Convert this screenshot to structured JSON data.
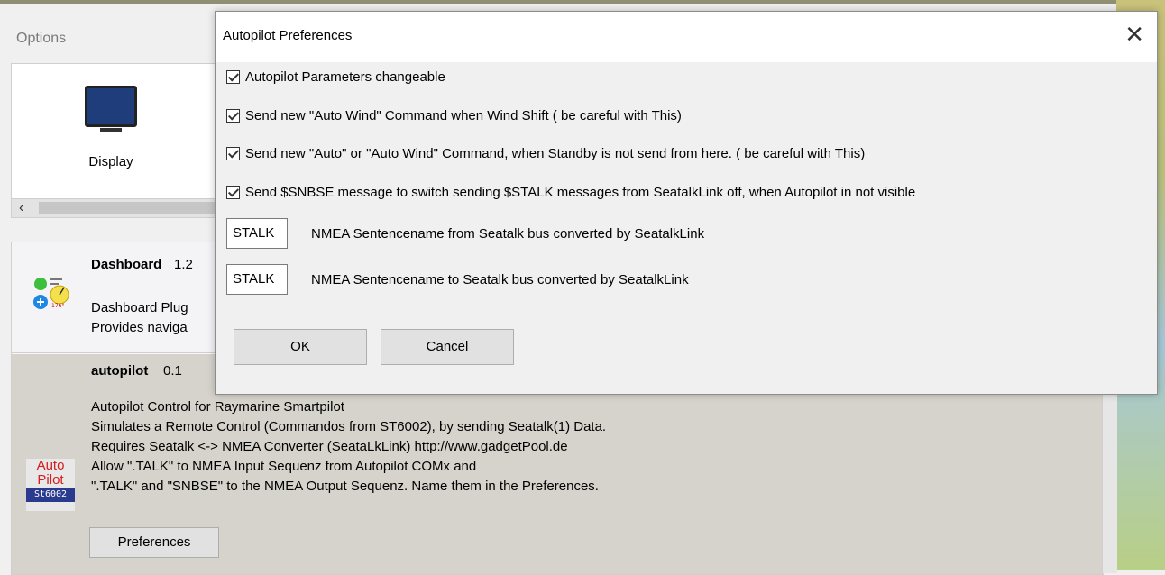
{
  "options": {
    "title": "Options",
    "display_label": "Display"
  },
  "plugins": {
    "dashboard": {
      "name": "Dashboard",
      "version": "1.2",
      "desc_1": "Dashboard Plug",
      "desc_2": "Provides naviga",
      "icon_value": "176°"
    },
    "autopilot": {
      "name": "autopilot",
      "version": "0.1",
      "desc_lines": [
        "Autopilot Control for Raymarine Smartpilot",
        "Simulates a Remote Control (Commandos from ST6002), by sending Seatalk(1) Data.",
        "Requires Seatalk <-> NMEA Converter (SeataLkLink) http://www.gadgetPool.de",
        "Allow \".TALK\" to NMEA Input Sequenz from Autopilot COMx and",
        "\".TALK\" and \"SNBSE\" to the NMEA Output Sequenz. Name them in the Preferences."
      ],
      "icon_line1": "Auto",
      "icon_line2": "Pilot",
      "icon_line3": "St6002",
      "preferences_label": "Preferences"
    }
  },
  "dialog": {
    "title": "Autopilot Preferences",
    "close_glyph": "✕",
    "checkboxes": [
      {
        "label": "Autopilot Parameters changeable",
        "checked": true
      },
      {
        "label": "Send new \"Auto Wind\" Command when Wind Shift ( be careful with This)",
        "checked": true
      },
      {
        "label": "Send new \"Auto\" or \"Auto Wind\" Command, when Standby is not send from here.  ( be careful with This)",
        "checked": true
      },
      {
        "label": "Send $SNBSE message to switch sending $STALK messages from SeatalkLink off, when Autopilot in not visible",
        "checked": true
      }
    ],
    "fields": [
      {
        "value": "STALK",
        "label": "NMEA Sentencename from  Seatalk bus converted by SeatalkLink"
      },
      {
        "value": "STALK",
        "label": "NMEA Sentencename to Seatalk bus converted by SeatalkLink"
      }
    ],
    "ok_label": "OK",
    "cancel_label": "Cancel"
  }
}
